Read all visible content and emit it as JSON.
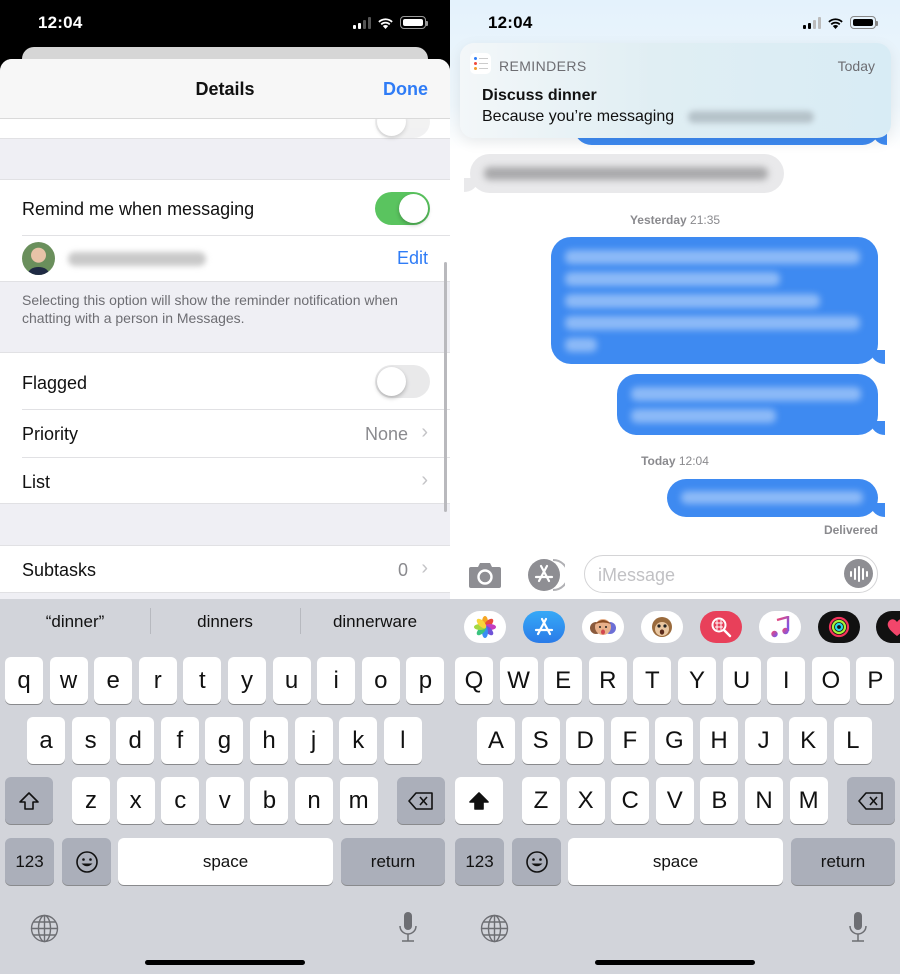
{
  "left": {
    "status": {
      "time": "12:04",
      "signal_bars": 2,
      "signal_max": 4
    },
    "nav": {
      "title": "Details",
      "done_label": "Done"
    },
    "remind_row": {
      "label": "Remind me when messaging",
      "toggle_on": true
    },
    "contact_row": {
      "name_blurred": true,
      "edit_label": "Edit"
    },
    "footnote": "Selecting this option will show the reminder notification when chatting with a person in Messages.",
    "flagged_row": {
      "label": "Flagged",
      "toggle_on": false
    },
    "priority_row": {
      "label": "Priority",
      "value": "None"
    },
    "list_row": {
      "label": "List",
      "value": ""
    },
    "subtasks_row": {
      "label": "Subtasks",
      "value": "0"
    },
    "keyboard": {
      "suggestions": [
        "“dinner”",
        "dinners",
        "dinnerware"
      ],
      "row1": [
        "q",
        "w",
        "e",
        "r",
        "t",
        "y",
        "u",
        "i",
        "o",
        "p"
      ],
      "row2": [
        "a",
        "s",
        "d",
        "f",
        "g",
        "h",
        "j",
        "k",
        "l"
      ],
      "row3": [
        "z",
        "x",
        "c",
        "v",
        "b",
        "n",
        "m"
      ],
      "numbers_label": "123",
      "space_label": "space",
      "return_label": "return",
      "shift_active": false
    }
  },
  "right": {
    "status": {
      "time": "12:04",
      "signal_bars": 2,
      "signal_max": 4
    },
    "notification": {
      "app": "REMINDERS",
      "time": "Today",
      "title": "Discuss dinner",
      "body": "Because you’re messaging"
    },
    "timestamps": [
      {
        "day": "Yesterday",
        "time": "21:35"
      },
      {
        "day": "Today",
        "time": "12:04"
      }
    ],
    "messages": [
      {
        "direction": "incoming",
        "blurred": true
      },
      {
        "direction": "outgoing",
        "blurred": true
      },
      {
        "direction": "outgoing",
        "blurred": true
      },
      {
        "direction": "outgoing",
        "blurred": true
      }
    ],
    "delivery_status": "Delivered",
    "input_placeholder": "iMessage",
    "app_strip": [
      "photos",
      "app-store",
      "memoji",
      "animoji",
      "images-search",
      "music",
      "activity",
      "digital-touch"
    ],
    "keyboard": {
      "row1": [
        "Q",
        "W",
        "E",
        "R",
        "T",
        "Y",
        "U",
        "I",
        "O",
        "P"
      ],
      "row2": [
        "A",
        "S",
        "D",
        "F",
        "G",
        "H",
        "J",
        "K",
        "L"
      ],
      "row3": [
        "Z",
        "X",
        "C",
        "V",
        "B",
        "N",
        "M"
      ],
      "numbers_label": "123",
      "space_label": "space",
      "return_label": "return",
      "shift_active": true
    }
  },
  "colors": {
    "ios_blue": "#2f7cf6",
    "bubble_blue": "#3e8af1",
    "toggle_green": "#5ac45f",
    "keyboard_bg": "#d2d4da"
  }
}
